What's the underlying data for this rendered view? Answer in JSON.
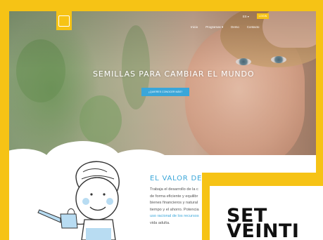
{
  "header": {
    "logo_text": "SET VEINTI UNO",
    "language": "ES ▾",
    "login_label": "LOGIN",
    "nav_items": [
      "Inicio",
      "Programas ▾",
      "Demo",
      "Contacto"
    ]
  },
  "hero": {
    "title": "SEMILLAS PARA CAMBIAR EL MUNDO",
    "cta_label": "¿QUIERES CONOCER MÁS?"
  },
  "section": {
    "title": "EL VALOR DE LAS COSAS",
    "lines": [
      "Trabaja el desarrollo de la c",
      "de forma eficiente y equilibr",
      "bienes financieros y natural",
      "tiempo y el ahorro. Potencia"
    ],
    "link_text": "uso racional de los recursos",
    "last_line": "vida adulta."
  },
  "card": {
    "title": "SET VEINTI"
  },
  "colors": {
    "brand_yellow": "#f6c315",
    "accent_blue": "#3aa6d9",
    "text_gray": "#555555"
  }
}
